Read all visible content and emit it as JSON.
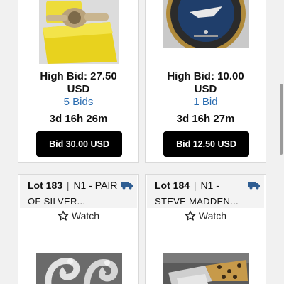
{
  "cards_top": [
    {
      "image_icon": "gold-watch-in-yellow-box",
      "high_bid": "High Bid: 27.50",
      "currency": "USD",
      "bids": "5 Bids",
      "time_left": "3d 16h 26m",
      "bid_button": "Bid 30.00 USD"
    },
    {
      "image_icon": "challenge-coin",
      "high_bid": "High Bid: 10.00",
      "currency": "USD",
      "bids": "1 Bid",
      "time_left": "3d 16h 27m",
      "bid_button": "Bid 12.50 USD"
    }
  ],
  "cards_bottom": [
    {
      "lot": "Lot 183",
      "separator": "|",
      "title_line1": "N1 - PAIR",
      "title_line2": "OF SILVER...",
      "shipping_icon": "truck-icon",
      "watch_icon": "star-outline-icon",
      "watch_label": "Watch",
      "image_icon": "silver-earrings"
    },
    {
      "lot": "Lot 184",
      "separator": "|",
      "title_line1": "N1 -",
      "title_line2": "STEVE MADDEN...",
      "shipping_icon": "truck-icon",
      "watch_icon": "star-outline-icon",
      "watch_label": "Watch",
      "image_icon": "leopard-print-sneakers"
    }
  ],
  "colors": {
    "bids_link": "#2a6cb0",
    "button_bg": "#000000",
    "truck": "#2e5d92"
  }
}
